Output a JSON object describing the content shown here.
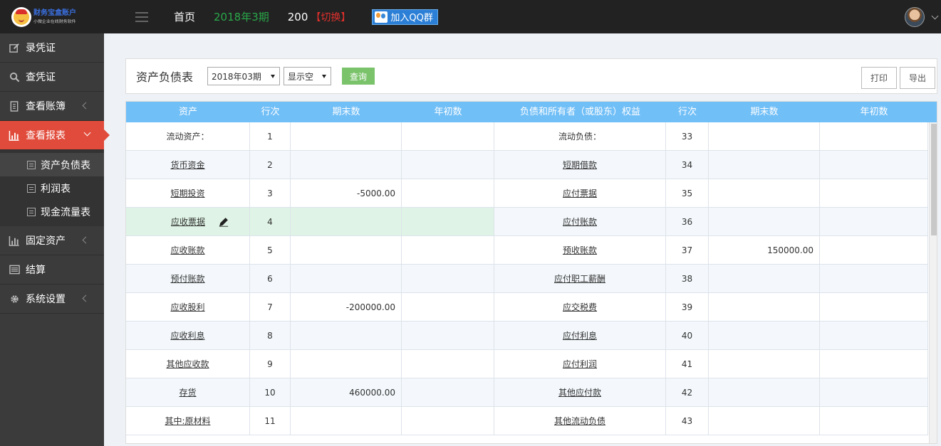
{
  "header": {
    "logo_title": "财务宝盒账户",
    "logo_subtitle": "小微企业在线财务软件",
    "home": "首页",
    "period": "2018年3期",
    "account_code": "200",
    "switch_label": "【切换】",
    "qq_label": "加入QQ群"
  },
  "sidebar": {
    "items": [
      {
        "label": "录凭证",
        "icon": "edit-icon"
      },
      {
        "label": "查凭证",
        "icon": "search-icon"
      },
      {
        "label": "查看账簿",
        "icon": "ledger-icon"
      },
      {
        "label": "查看报表",
        "icon": "bar-chart-icon"
      },
      {
        "label": "固定资产",
        "icon": "bar-chart-icon"
      },
      {
        "label": "结算",
        "icon": "list-icon"
      },
      {
        "label": "系统设置",
        "icon": "gear-icon"
      }
    ],
    "sub_items": [
      {
        "label": "资产负债表"
      },
      {
        "label": "利润表"
      },
      {
        "label": "现金流量表"
      }
    ],
    "colors": {
      "bg": "#3b3b3b",
      "active": "#e14b3b"
    }
  },
  "toolbar": {
    "title": "资产负债表",
    "period_value": "2018年03期",
    "show_value": "显示空",
    "query": "查询",
    "print": "打印",
    "export": "导出"
  },
  "table": {
    "headers": [
      "资产",
      "行次",
      "期末数",
      "年初数",
      "负债和所有者（或股东）权益",
      "行次",
      "期末数",
      "年初数"
    ],
    "rows": [
      {
        "asset": "流动资产：",
        "row": "1",
        "end": "",
        "begin": "",
        "liability": "流动负债：",
        "lrow": "33",
        "lend": "",
        "lbegin": ""
      },
      {
        "asset": "货币资金",
        "row": "2",
        "end": "",
        "begin": "",
        "liability": "短期借款",
        "lrow": "34",
        "lend": "",
        "lbegin": ""
      },
      {
        "asset": "短期投资",
        "row": "3",
        "end": "-5000.00",
        "begin": "",
        "liability": "应付票据",
        "lrow": "35",
        "lend": "",
        "lbegin": ""
      },
      {
        "asset": "应收票据",
        "row": "4",
        "end": "",
        "begin": "",
        "liability": "应付账款",
        "lrow": "36",
        "lend": "",
        "lbegin": ""
      },
      {
        "asset": "应收账款",
        "row": "5",
        "end": "",
        "begin": "",
        "liability": "预收账款",
        "lrow": "37",
        "lend": "150000.00",
        "lbegin": ""
      },
      {
        "asset": "预付账款",
        "row": "6",
        "end": "",
        "begin": "",
        "liability": "应付职工薪酬",
        "lrow": "38",
        "lend": "",
        "lbegin": ""
      },
      {
        "asset": "应收股利",
        "row": "7",
        "end": "-200000.00",
        "begin": "",
        "liability": "应交税费",
        "lrow": "39",
        "lend": "",
        "lbegin": ""
      },
      {
        "asset": "应收利息",
        "row": "8",
        "end": "",
        "begin": "",
        "liability": "应付利息",
        "lrow": "40",
        "lend": "",
        "lbegin": ""
      },
      {
        "asset": "其他应收款",
        "row": "9",
        "end": "",
        "begin": "",
        "liability": "应付利润",
        "lrow": "41",
        "lend": "",
        "lbegin": ""
      },
      {
        "asset": "存货",
        "row": "10",
        "end": "460000.00",
        "begin": "",
        "liability": "其他应付款",
        "lrow": "42",
        "lend": "",
        "lbegin": ""
      },
      {
        "asset": "其中:原材料",
        "row": "11",
        "end": "",
        "begin": "",
        "liability": "其他流动负债",
        "lrow": "43",
        "lend": "",
        "lbegin": ""
      }
    ],
    "colors": {
      "header_bg": "#71bff7",
      "edit_row": "#dff4e6"
    }
  }
}
